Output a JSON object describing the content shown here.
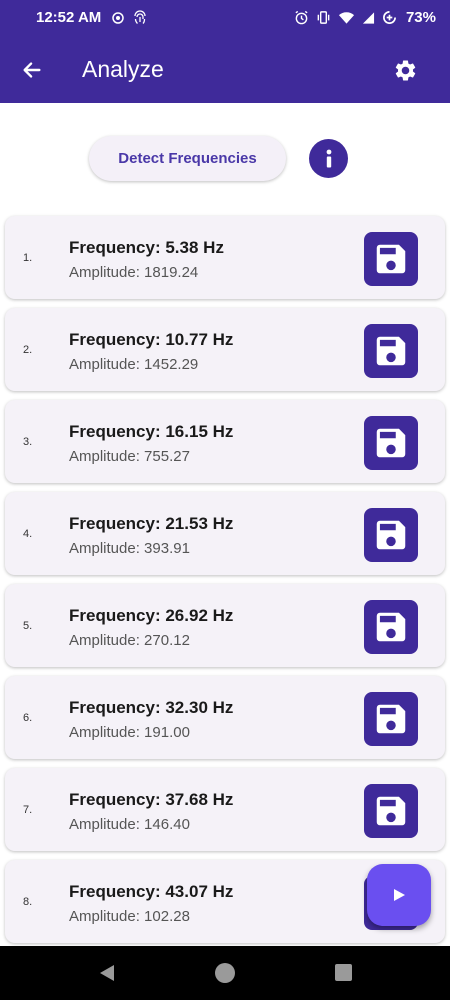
{
  "status_bar": {
    "time": "12:52 AM",
    "battery": "73%"
  },
  "app_bar": {
    "title": "Analyze"
  },
  "actions": {
    "detect_label": "Detect Frequencies"
  },
  "results": [
    {
      "index": "1.",
      "frequency": "Frequency: 5.38 Hz",
      "amplitude": "Amplitude: 1819.24"
    },
    {
      "index": "2.",
      "frequency": "Frequency: 10.77 Hz",
      "amplitude": "Amplitude: 1452.29"
    },
    {
      "index": "3.",
      "frequency": "Frequency: 16.15 Hz",
      "amplitude": "Amplitude: 755.27"
    },
    {
      "index": "4.",
      "frequency": "Frequency: 21.53 Hz",
      "amplitude": "Amplitude: 393.91"
    },
    {
      "index": "5.",
      "frequency": "Frequency: 26.92 Hz",
      "amplitude": "Amplitude: 270.12"
    },
    {
      "index": "6.",
      "frequency": "Frequency: 32.30 Hz",
      "amplitude": "Amplitude: 191.00"
    },
    {
      "index": "7.",
      "frequency": "Frequency: 37.68 Hz",
      "amplitude": "Amplitude: 146.40"
    },
    {
      "index": "8.",
      "frequency": "Frequency: 43.07 Hz",
      "amplitude": "Amplitude: 102.28"
    }
  ],
  "icons": {
    "back": "arrow-back-icon",
    "settings": "gear-icon",
    "info": "info-icon",
    "save": "floppy-disk-icon",
    "play": "play-icon"
  },
  "colors": {
    "primary": "#3f2a9a",
    "fab": "#6a4ff0",
    "card_background": "#f5f2f8",
    "detect_text": "#4a38a8"
  }
}
